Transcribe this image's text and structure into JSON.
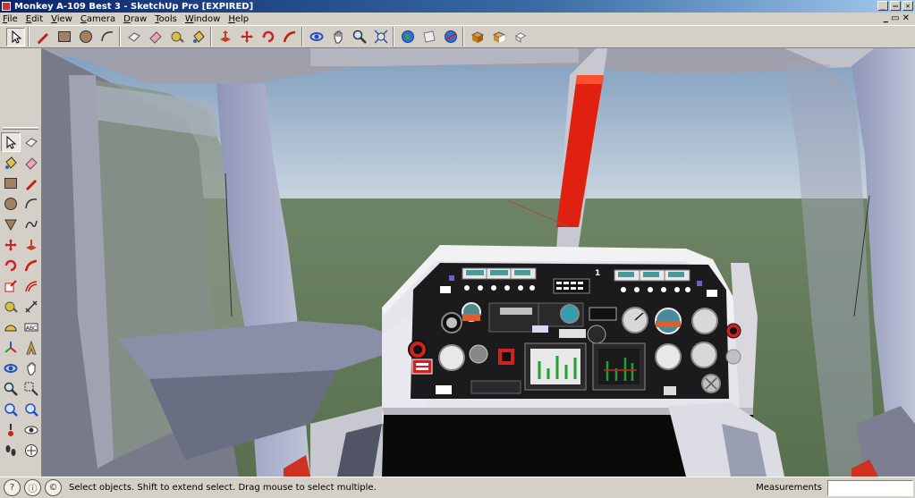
{
  "window": {
    "title": "Monkey A-109 Best 3 - SketchUp Pro [EXPIRED]",
    "minimize": "_",
    "restore": "▭",
    "close": "✕"
  },
  "menu": {
    "items": [
      "File",
      "Edit",
      "View",
      "Camera",
      "Draw",
      "Tools",
      "Window",
      "Help"
    ],
    "doc_controls": "_ ▭ ✕"
  },
  "toolbar": {
    "tools": [
      "select-icon",
      "pencil-icon",
      "rectangle-icon",
      "circle-icon",
      "arc-icon",
      "eraser-icon",
      "paint-bucket-icon",
      "tape-measure-icon",
      "protractor-icon",
      "push-pull-icon",
      "move-icon",
      "rotate-icon",
      "follow-me-icon",
      "orbit-icon",
      "pan-icon",
      "zoom-icon",
      "zoom-extents-icon",
      "globe-icon",
      "place-model-icon",
      "share-model-icon",
      "get-models-icon",
      "component-icon",
      "warehouse-icon"
    ]
  },
  "left_toolbar": {
    "tools": [
      "select-icon",
      "make-component-icon",
      "paint-bucket-icon",
      "eraser-icon",
      "rectangle-icon",
      "line-icon",
      "circle-icon",
      "arc-icon",
      "polygon-icon",
      "freehand-icon",
      "move-icon",
      "push-pull-icon",
      "rotate-icon",
      "follow-me-icon",
      "scale-icon",
      "offset-icon",
      "tape-measure-icon",
      "dimension-icon",
      "protractor-icon",
      "text-icon",
      "axes-icon",
      "3d-text-icon",
      "orbit-icon",
      "pan-icon",
      "zoom-icon",
      "zoom-window-icon",
      "previous-view-icon",
      "next-view-icon",
      "position-camera-icon",
      "look-around-icon",
      "walk-icon",
      "section-plane-icon"
    ]
  },
  "viewport": {
    "sky_color": "#a8c0d8",
    "ground_color": "#6a8058",
    "rotor_accent": "#e02010",
    "gauge_labels": [
      "1"
    ]
  },
  "status": {
    "message": "Select objects. Shift to extend select. Drag mouse to select multiple.",
    "measurements_label": "Measurements",
    "measurements_value": ""
  }
}
